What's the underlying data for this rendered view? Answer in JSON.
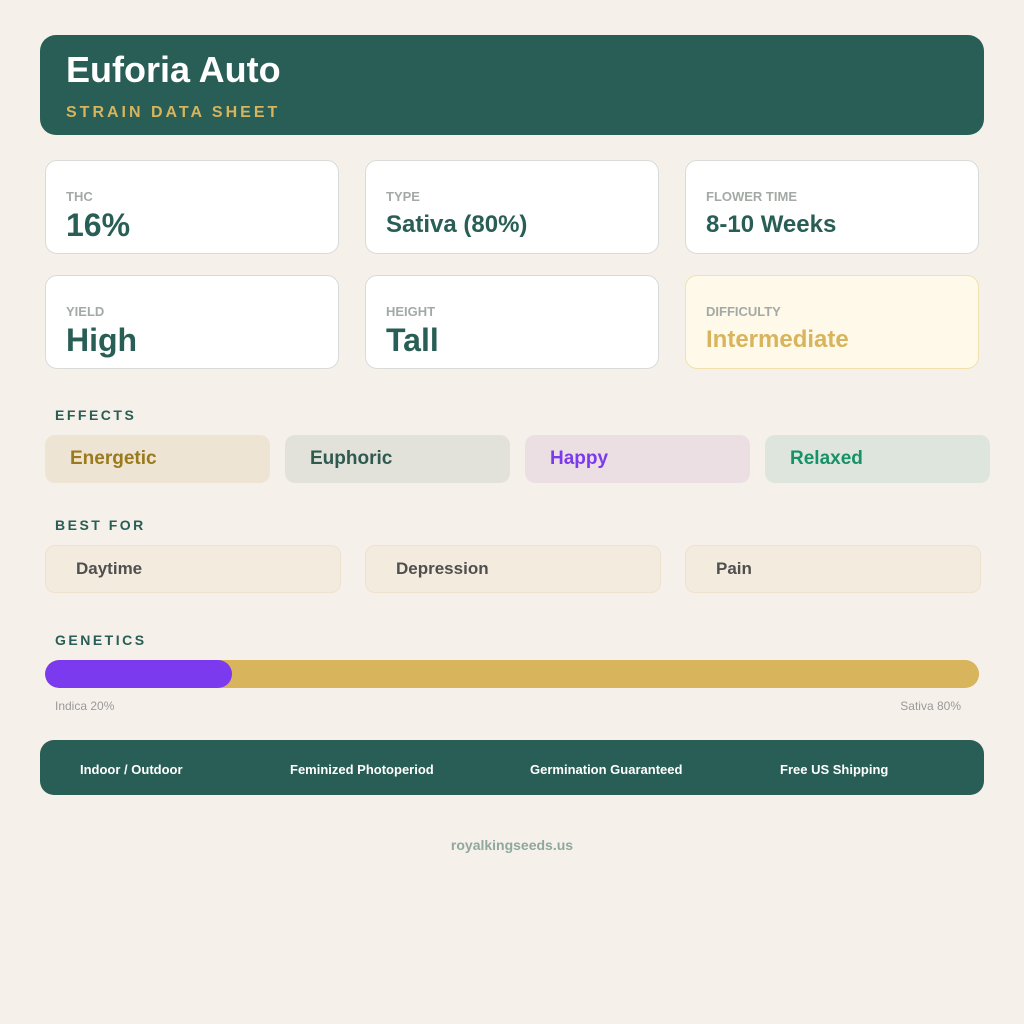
{
  "header": {
    "title": "Euforia Auto",
    "subtitle": "STRAIN DATA SHEET"
  },
  "stats": {
    "thc": {
      "label": "THC",
      "value": "16%"
    },
    "type": {
      "label": "TYPE",
      "value": "Sativa (80%)"
    },
    "flower_time": {
      "label": "FLOWER TIME",
      "value": "8-10 Weeks"
    },
    "yield": {
      "label": "YIELD",
      "value": "High"
    },
    "height": {
      "label": "HEIGHT",
      "value": "Tall"
    },
    "difficulty": {
      "label": "DIFFICULTY",
      "value": "Intermediate"
    }
  },
  "effects": {
    "title": "EFFECTS",
    "items": [
      {
        "label": "Energetic",
        "color": "#9a7a1c",
        "bg": "#ede4d3"
      },
      {
        "label": "Euphoric",
        "color": "#2f5a50",
        "bg": "#e2e1da"
      },
      {
        "label": "Happy",
        "color": "#7b3aed",
        "bg": "#ebdfe4"
      },
      {
        "label": "Relaxed",
        "color": "#16926a",
        "bg": "#dde5dc"
      }
    ]
  },
  "best_for": {
    "title": "BEST FOR",
    "items": [
      "Daytime",
      "Depression",
      "Pain"
    ]
  },
  "genetics": {
    "title": "GENETICS",
    "indica_label": "Indica 20%",
    "sativa_label": "Sativa 80%",
    "indica_percent": 20,
    "sativa_percent": 80,
    "indica_color": "#7b3aed",
    "sativa_color": "#d8b45c"
  },
  "features": [
    "Indoor / Outdoor",
    "Feminized Photoperiod",
    "Germination Guaranteed",
    "Free US Shipping"
  ],
  "website": "royalkingseeds.us",
  "colors": {
    "primary": "#285e55",
    "accent": "#d8b45c",
    "background": "#f5f0ea"
  }
}
